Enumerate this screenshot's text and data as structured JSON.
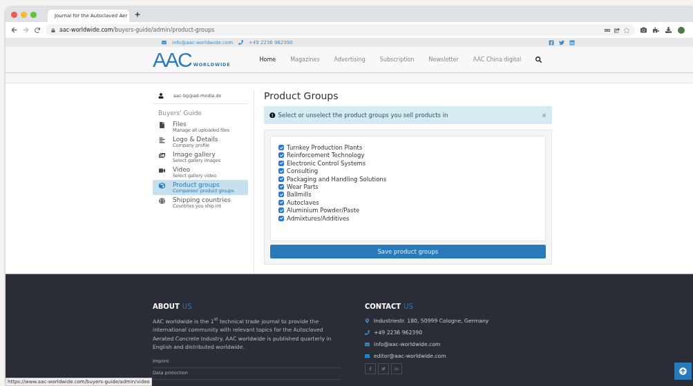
{
  "browser": {
    "tab_title": "Journal for the Autoclaved Aer",
    "url_domain": "aac-worldwide.com",
    "url_path": "/buyers-guide/admin/product-groups",
    "status_url": "https://www.aac-worldwide.com/buyers-guide/admin/video"
  },
  "topbar": {
    "email": "info@aac-worldwide.com",
    "phone": "+49 2236 962390"
  },
  "header": {
    "logo_main": "AAC",
    "logo_sub": "WORLDWIDE",
    "nav": [
      {
        "label": "Home",
        "selected": true
      },
      {
        "label": "Magazines",
        "selected": false
      },
      {
        "label": "Advertising",
        "selected": false
      },
      {
        "label": "Subscription",
        "selected": false
      },
      {
        "label": "Newsletter",
        "selected": false
      },
      {
        "label": "AAC China digital",
        "selected": false
      }
    ]
  },
  "sidebar": {
    "user": "aac-bg@ad-media.de",
    "section": "Buyers' Guide",
    "items": [
      {
        "kind": "file",
        "title": "Files",
        "subtitle": "Manage all uploaded files",
        "selected": false
      },
      {
        "kind": "list",
        "title": "Logo & Details",
        "subtitle": "Company profile",
        "selected": false
      },
      {
        "kind": "image",
        "title": "Image gallery",
        "subtitle": "Select gallery images",
        "selected": false
      },
      {
        "kind": "video",
        "title": "Video",
        "subtitle": "Select gallery video",
        "selected": false
      },
      {
        "kind": "cube",
        "title": "Product groups",
        "subtitle": "Companies' product groups",
        "selected": true
      },
      {
        "kind": "globe",
        "title": "Shipping countries",
        "subtitle": "Countries you ship int",
        "selected": false
      }
    ]
  },
  "main": {
    "title": "Product Groups",
    "alert": "Select or unselect the product groups you sell products in",
    "groups": [
      {
        "label": "Turnkey Production Plants",
        "checked": true
      },
      {
        "label": "Reinforcement Technology",
        "checked": true
      },
      {
        "label": "Electronic Control Systems",
        "checked": true
      },
      {
        "label": "Consulting",
        "checked": true
      },
      {
        "label": "Packaging and Handling Solutions",
        "checked": true
      },
      {
        "label": "Wear Parts",
        "checked": true
      },
      {
        "label": "Ballmills",
        "checked": true
      },
      {
        "label": "Autoclaves",
        "checked": true
      },
      {
        "label": "Aluminium Powder/Paste",
        "checked": true
      },
      {
        "label": "Admixtures/Additives",
        "checked": true
      }
    ],
    "save_button": "Save product groups"
  },
  "footer": {
    "about": {
      "title": "ABOUT",
      "accent": "US",
      "text": "AAC worldwide is the 1$^{st}$ technical trade journal to provide the international community with relevant topics for the Autoclaved Aerated Concrete Industry. AAC worldwide is published quarterly in English and distributed worldwide.",
      "links": [
        "Imprint",
        "Data protection"
      ]
    },
    "contact": {
      "title": "CONTACT",
      "accent": "US",
      "items": [
        {
          "kind": "address",
          "text": "Industriestr. 180, 50999 Cologne, Germany"
        },
        {
          "kind": "phone",
          "text": "+49 2236 962390"
        },
        {
          "kind": "email",
          "text": "info@aac-worldwide.com"
        },
        {
          "kind": "email",
          "text": "editor@aac-worldwide.com"
        }
      ]
    }
  }
}
